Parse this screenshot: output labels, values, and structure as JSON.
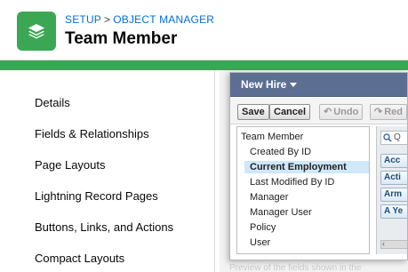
{
  "header": {
    "breadcrumb": [
      "SETUP",
      "OBJECT MANAGER"
    ],
    "breadcrumb_separator": ">",
    "title": "Team Member",
    "icon": "layers-icon",
    "accent_color": "#3ba755"
  },
  "sidebar": {
    "items": [
      {
        "label": "Details"
      },
      {
        "label": "Fields & Relationships"
      },
      {
        "label": "Page Layouts"
      },
      {
        "label": "Lightning Record Pages"
      },
      {
        "label": "Buttons, Links, and Actions"
      },
      {
        "label": "Compact Layouts"
      }
    ]
  },
  "editor": {
    "layout_name": "New Hire",
    "toolbar": {
      "save": "Save",
      "cancel": "Cancel",
      "undo": "Undo",
      "redo": "Red"
    },
    "tree": {
      "root": "Team Member",
      "items": [
        {
          "label": "Created By ID",
          "selected": false
        },
        {
          "label": "Current Employment",
          "selected": true
        },
        {
          "label": "Last Modified By ID",
          "selected": false
        },
        {
          "label": "Manager",
          "selected": false
        },
        {
          "label": "Manager User",
          "selected": false
        },
        {
          "label": "Policy",
          "selected": false
        },
        {
          "label": "User",
          "selected": false
        }
      ]
    },
    "palette": {
      "search_placeholder": "Q",
      "chips": [
        "Acc",
        "Acti",
        "Arm",
        "A Ye"
      ]
    },
    "footer_hint": "Preview of the fields shown in the"
  }
}
